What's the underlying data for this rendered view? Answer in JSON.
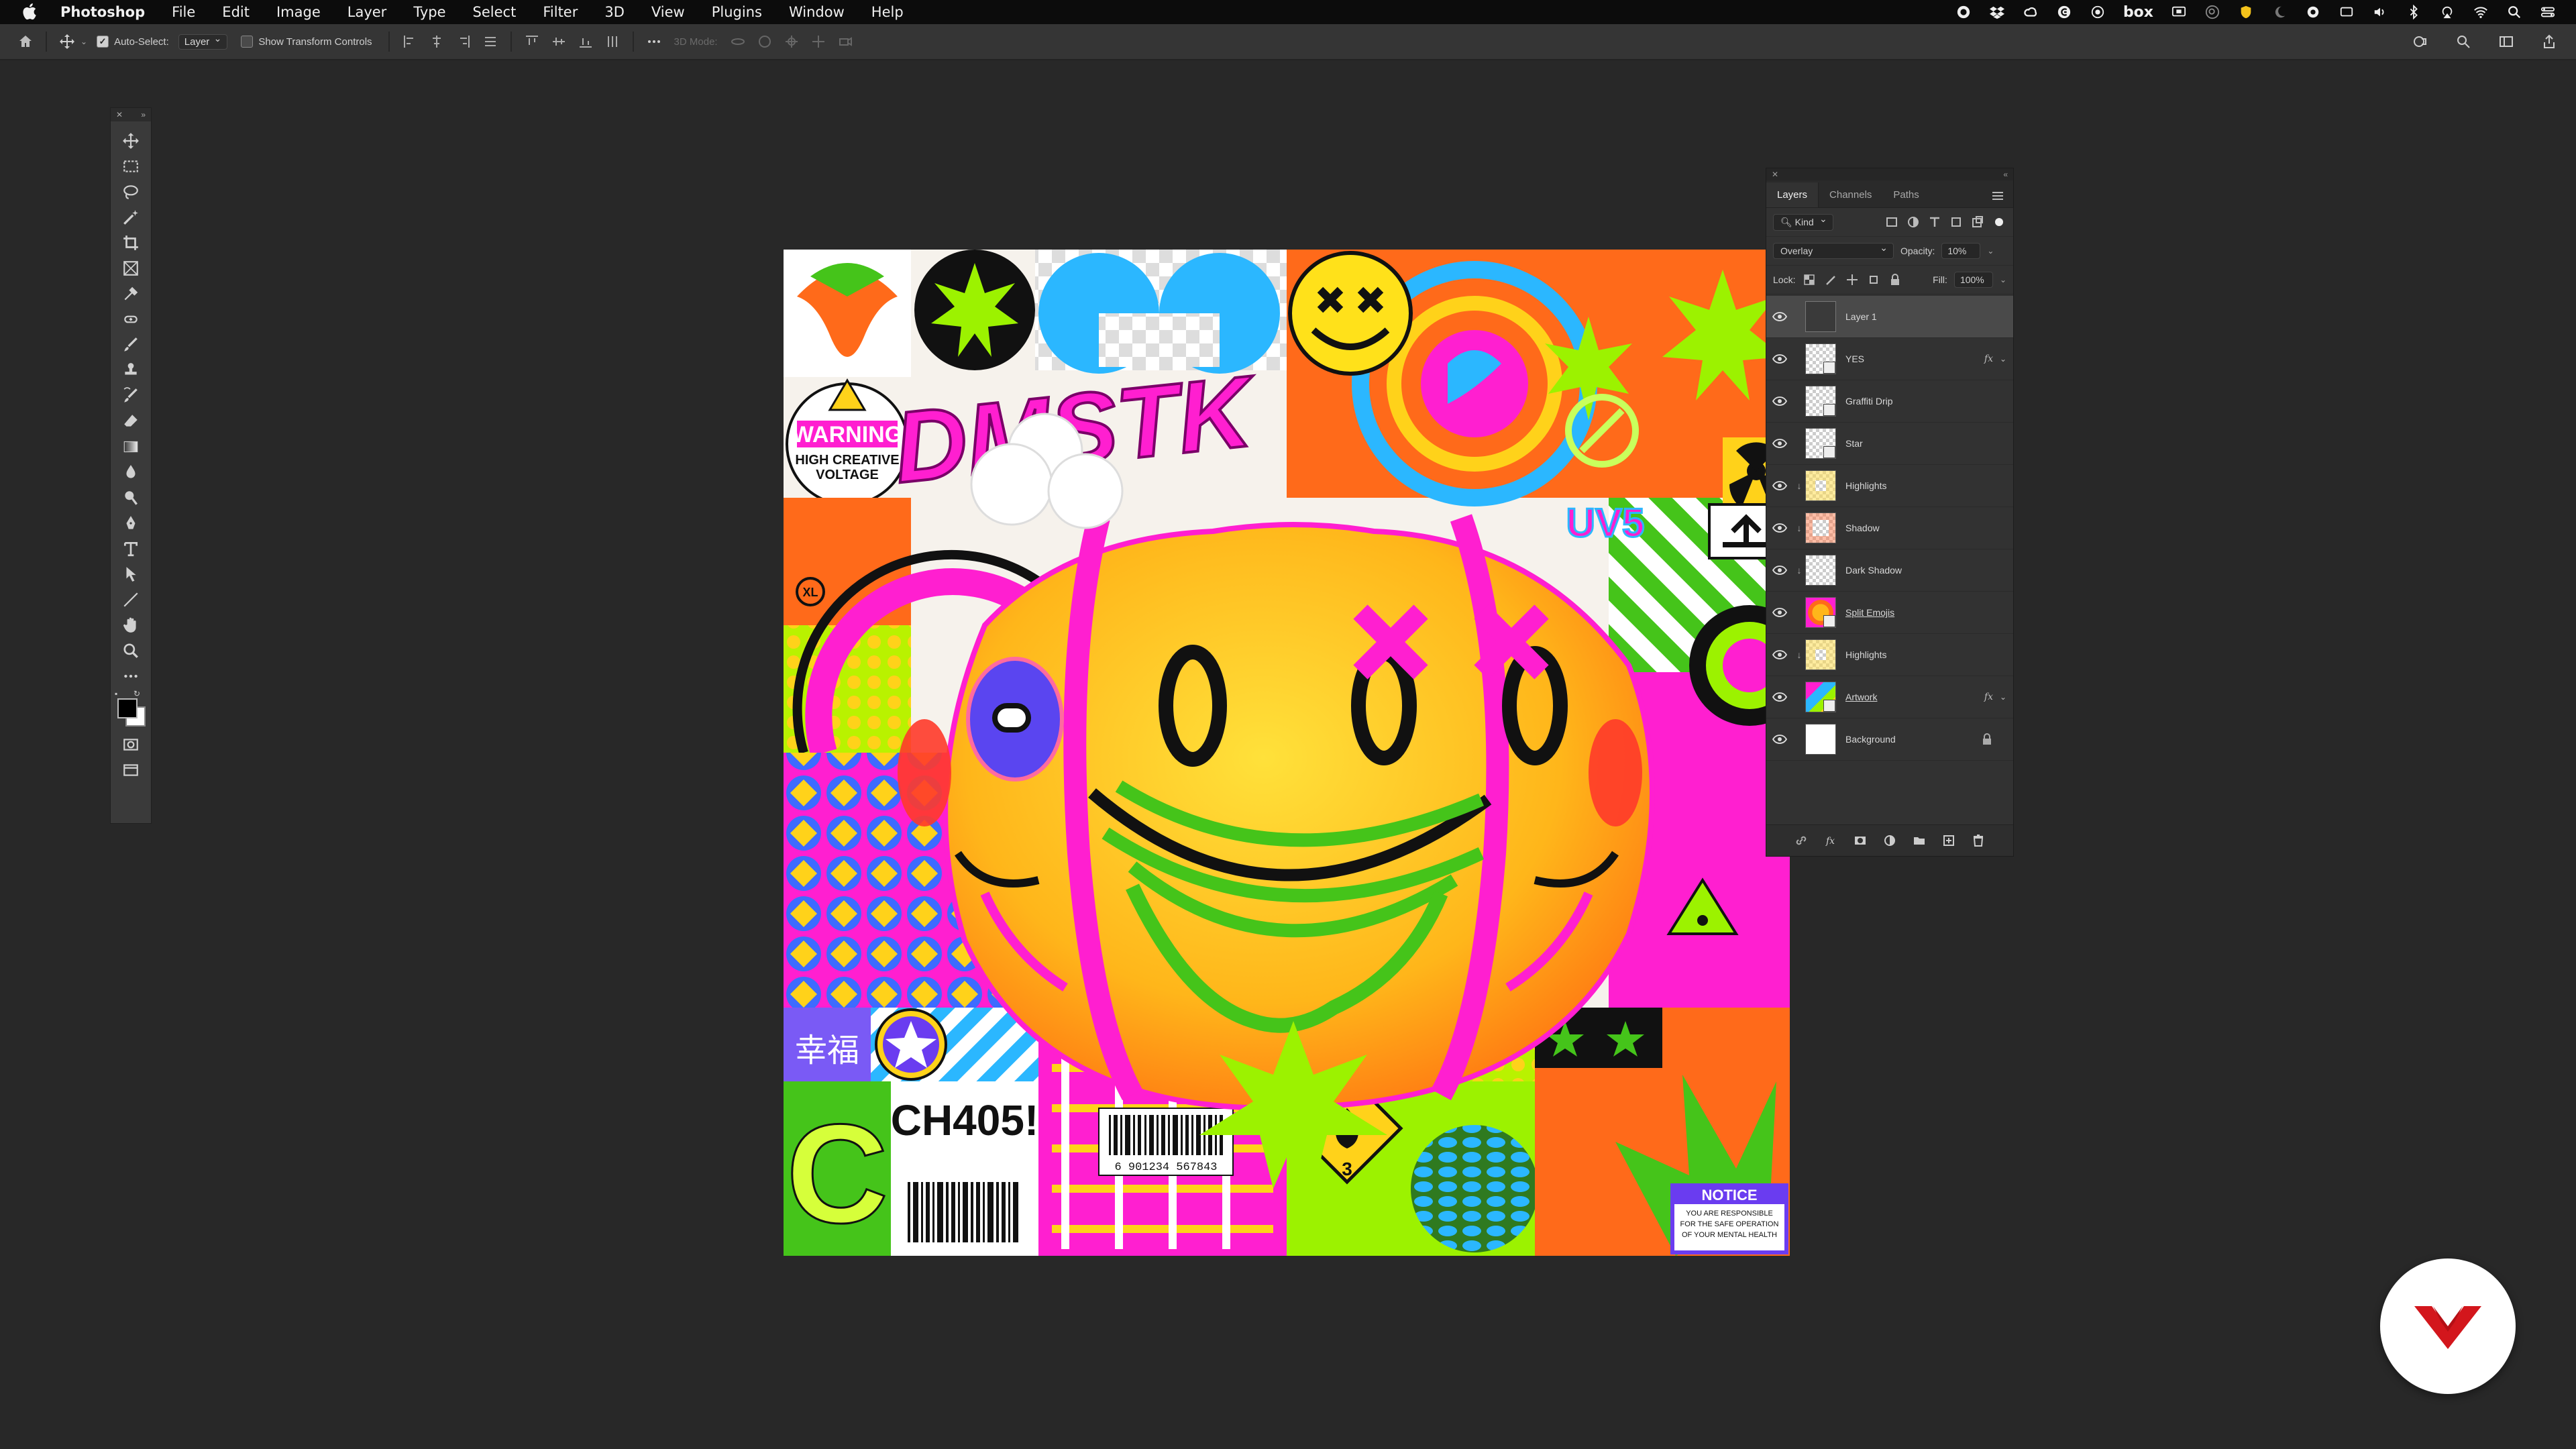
{
  "menubar": {
    "app_name": "Photoshop",
    "items": [
      "File",
      "Edit",
      "Image",
      "Layer",
      "Type",
      "Select",
      "Filter",
      "3D",
      "View",
      "Plugins",
      "Window",
      "Help"
    ],
    "status_text": "box",
    "status_icons": [
      "record-icon",
      "dropbox-icon",
      "creative-cloud-icon",
      "g-icon",
      "circle-icon",
      "box-icon",
      "screen-icon",
      "search-circle-icon",
      "shield-icon",
      "moon-icon",
      "camera-icon",
      "display-icon",
      "volume-icon",
      "bluetooth-icon",
      "airplay-icon",
      "wifi-icon",
      "spotlight-icon",
      "control-center-icon"
    ]
  },
  "options_bar": {
    "auto_select_label": "Auto-Select:",
    "auto_select_checked": true,
    "auto_select_value": "Layer",
    "show_transform_label": "Show Transform Controls",
    "show_transform_checked": false,
    "mode_3d_label": "3D Mode:"
  },
  "canvas_text": {
    "warning": "WARNING",
    "high_creative": "HIGH CREATIVE",
    "voltage": "VOLTAGE",
    "dmstk": "DMSTK",
    "xl": "XL",
    "kanji": "幸福",
    "c_letter": "C",
    "ch405": "CH405!",
    "barcode_number": "6 901234 567843",
    "hazard_number": "3",
    "notice": "NOTICE",
    "notice_line1": "YOU ARE RESPONSIBLE",
    "notice_line2": "FOR THE SAFE OPERATION",
    "notice_line3": "OF YOUR MENTAL HEALTH",
    "uvs": "UV5"
  },
  "layers_panel": {
    "tabs": [
      "Layers",
      "Channels",
      "Paths"
    ],
    "active_tab": "Layers",
    "filter_kind": "Kind",
    "blend_mode": "Overlay",
    "opacity_label": "Opacity:",
    "opacity_value": "10%",
    "lock_label": "Lock:",
    "fill_label": "Fill:",
    "fill_value": "100%",
    "layers": [
      {
        "name": "Layer 1",
        "thumb": "dark",
        "selected": true,
        "clip": false,
        "fx": false,
        "underline": false
      },
      {
        "name": "YES",
        "thumb": "checker-doc",
        "selected": false,
        "clip": false,
        "fx": true,
        "underline": false
      },
      {
        "name": "Graffiti Drip",
        "thumb": "checker-doc",
        "selected": false,
        "clip": false,
        "fx": false,
        "underline": false
      },
      {
        "name": "Star",
        "thumb": "checker-doc",
        "selected": false,
        "clip": false,
        "fx": false,
        "underline": false
      },
      {
        "name": "Highlights",
        "thumb": "checker-yellow",
        "selected": false,
        "clip": true,
        "fx": false,
        "underline": false
      },
      {
        "name": "Shadow",
        "thumb": "checker-red",
        "selected": false,
        "clip": true,
        "fx": false,
        "underline": false
      },
      {
        "name": "Dark Shadow",
        "thumb": "checker",
        "selected": false,
        "clip": true,
        "fx": false,
        "underline": false
      },
      {
        "name": "Split Emojis",
        "thumb": "art",
        "selected": false,
        "clip": false,
        "fx": false,
        "underline": true
      },
      {
        "name": "Highlights",
        "thumb": "checker-yellow",
        "selected": false,
        "clip": true,
        "fx": false,
        "underline": false
      },
      {
        "name": "Artwork",
        "thumb": "art2",
        "selected": false,
        "clip": false,
        "fx": true,
        "underline": true
      },
      {
        "name": "Background",
        "thumb": "white",
        "selected": false,
        "clip": false,
        "fx": false,
        "underline": false,
        "locked": true
      }
    ],
    "fx_label": "fx"
  },
  "colors": {
    "accent_magenta": "#ff1fd0",
    "accent_lime": "#9cf200",
    "accent_yellow": "#ffd21a",
    "accent_orange": "#ff7a1a",
    "accent_cyan": "#2bb7ff",
    "logo_red": "#d3161c"
  }
}
